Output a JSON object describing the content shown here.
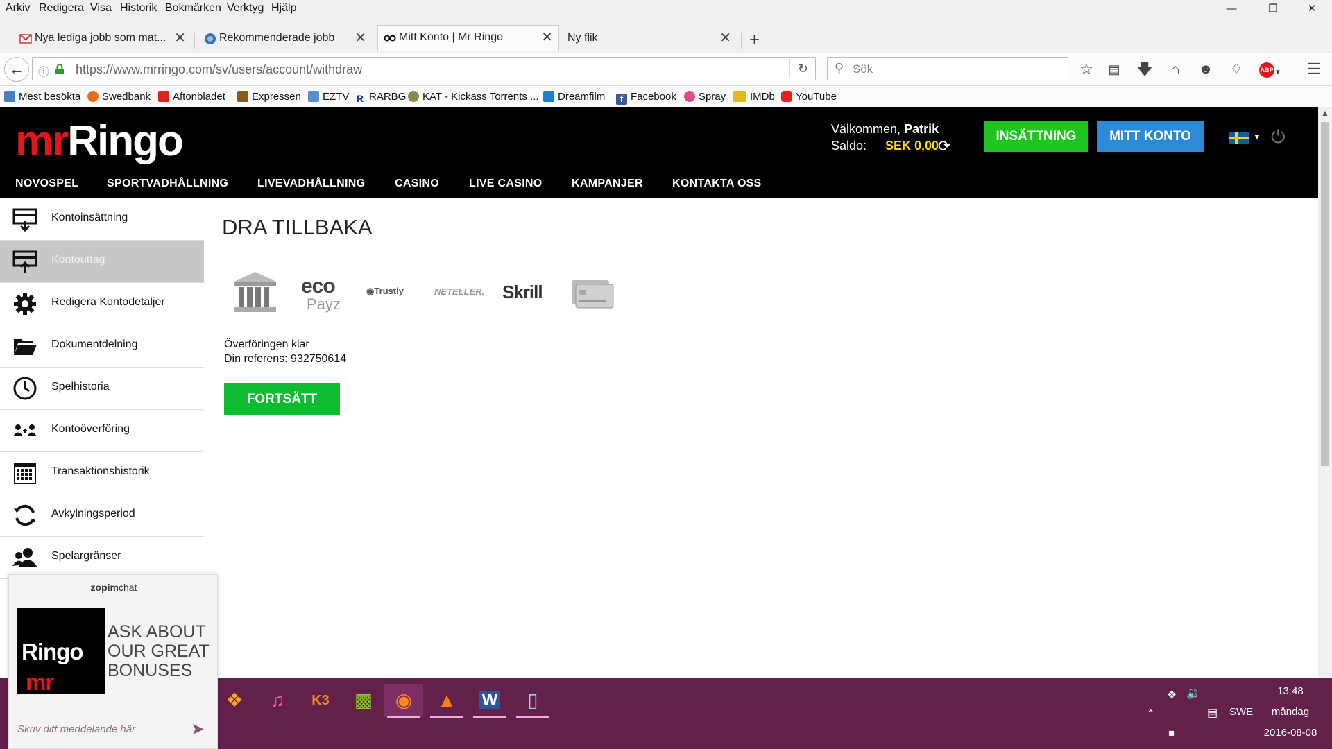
{
  "browser": {
    "menu": [
      "Arkiv",
      "Redigera",
      "Visa",
      "Historik",
      "Bokmärken",
      "Verktyg",
      "Hjälp"
    ],
    "tabs": [
      {
        "title": "Nya lediga jobb som mat...",
        "icon": "gmail-icon"
      },
      {
        "title": "Rekommenderade jobb",
        "icon": "site-icon"
      },
      {
        "title": "Mitt Konto | Mr Ringo",
        "icon": "mrringo-icon",
        "active": true
      },
      {
        "title": "Ny flik",
        "icon": ""
      }
    ],
    "url": "https://www.mrringo.com/sv/users/account/withdraw",
    "search_placeholder": "Sök",
    "bookmarks": [
      "Mest besökta",
      "Swedbank",
      "Aftonbladet",
      "Expressen",
      "EZTV",
      "RARBG",
      "KAT - Kickass Torrents ...",
      "Dreamfilm",
      "Facebook",
      "Spray",
      "IMDb",
      "YouTube"
    ],
    "bookmark_prefix_imdb": "IMDb"
  },
  "site": {
    "logo_a": "mr",
    "logo_b": "Ringo",
    "welcome_prefix": "Välkommen,",
    "welcome_name": "Patrik",
    "saldo_label": "Saldo:",
    "saldo_value": "SEK 0,00",
    "deposit_button": "INSÄTTNING",
    "account_button": "MITT KONTO",
    "nav": [
      "NOVOSPEL",
      "SPORTVADHÅLLNING",
      "LIVEVADHÅLLNING",
      "CASINO",
      "LIVE CASINO",
      "KAMPANJER",
      "KONTAKTA OSS"
    ],
    "colors": {
      "brand_red": "#e4141e",
      "deposit_green": "#1fc51f",
      "account_blue": "#2d8ad6",
      "balance_yellow": "#ffd800",
      "continue_green": "#0dbd2f"
    }
  },
  "sidebar": {
    "items": [
      {
        "label": "Kontoinsättning",
        "icon": "deposit-icon"
      },
      {
        "label": "Kontouttag",
        "icon": "withdraw-icon",
        "active": true
      },
      {
        "label": "Redigera Kontodetaljer",
        "icon": "gear-icon"
      },
      {
        "label": "Dokumentdelning",
        "icon": "folder-icon"
      },
      {
        "label": "Spelhistoria",
        "icon": "clock-icon"
      },
      {
        "label": "Kontoöverföring",
        "icon": "transfer-users-icon"
      },
      {
        "label": "Transaktionshistorik",
        "icon": "calendar-icon"
      },
      {
        "label": "Avkylningsperiod",
        "icon": "cycle-icon"
      },
      {
        "label": "Spelargränser",
        "icon": "users-icon"
      }
    ]
  },
  "content": {
    "title": "DRA TILLBAKA",
    "payment_methods": [
      "bank",
      "ecoPayz",
      "Trustly",
      "NETELLER",
      "Skrill",
      "card"
    ],
    "eco_a": "eco",
    "eco_b": "Payz",
    "trustly": "Trustly",
    "neteller": "NETELLER.",
    "skrill": "Skrill",
    "status_line1": "Överföringen klar",
    "status_line2": "Din referens: 932750614",
    "continue_button": "FORTSÄTT"
  },
  "chat": {
    "header_a": "zopim",
    "header_b": "chat",
    "logo_a": "mr",
    "logo_b": "Ringo",
    "promo": "ASK ABOUT OUR GREAT BONUSES",
    "input_placeholder": "Skriv ditt meddelande här"
  },
  "taskbar": {
    "time": "13:48",
    "day": "måndag",
    "date": "2016-08-08",
    "lang": "SWE"
  }
}
